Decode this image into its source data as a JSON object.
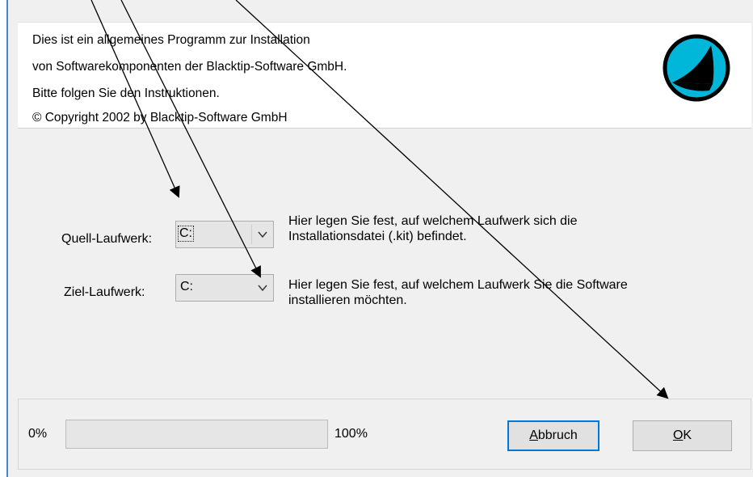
{
  "info": {
    "line1": "Dies ist ein allgemeines Programm zur Installation",
    "line2": "von Softwarekomponenten der Blacktip-Software GmbH.",
    "line3": "Bitte folgen Sie den Instruktionen.",
    "line4": "© Copyright 2002 by Blacktip-Software GmbH",
    "logo_icon": "blacktip-shark-fin-logo"
  },
  "source": {
    "label": "Quell-Laufwerk:",
    "value": "C:",
    "help1": "Hier legen Sie fest, auf welchem Laufwerk sich die",
    "help2": "Installationsdatei (.kit) befindet."
  },
  "target": {
    "label": "Ziel-Laufwerk:",
    "value": "C:",
    "help1": "Hier legen Sie fest, auf welchem Laufwerk Sie die Software",
    "help2": "installieren möchten."
  },
  "progress": {
    "min_label": "0%",
    "max_label": "100%",
    "value": 0
  },
  "buttons": {
    "cancel_rest": "bbruch",
    "cancel_accel": "A",
    "ok_rest": "K",
    "ok_accel": "O"
  },
  "colors": {
    "accent": "#0078d7",
    "logo_fill": "#00b7d9"
  }
}
